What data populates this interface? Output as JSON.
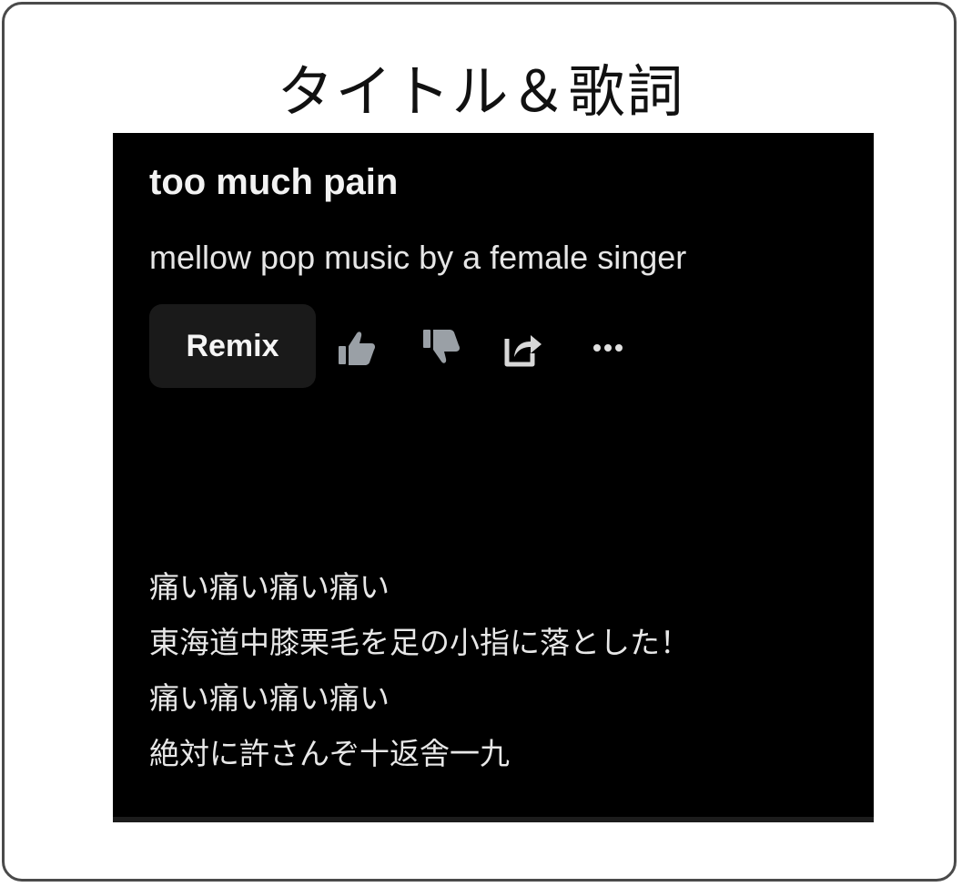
{
  "heading": "タイトル＆歌詞",
  "song": {
    "title": "too much pain",
    "description": "mellow pop music by a female singer"
  },
  "actions": {
    "remix_label": "Remix",
    "icons": [
      "thumbs-up-icon",
      "thumbs-down-icon",
      "share-icon",
      "more-options-icon"
    ]
  },
  "lyrics": [
    "痛い痛い痛い痛い",
    "東海道中膝栗毛を足の小指に落とした！",
    "痛い痛い痛い痛い",
    "絶対に許さんぞ十返舎一九"
  ],
  "colors": {
    "panel_bg": "#000000",
    "icon_gray": "#9aa0a6",
    "button_bg": "#1a1a1a"
  }
}
